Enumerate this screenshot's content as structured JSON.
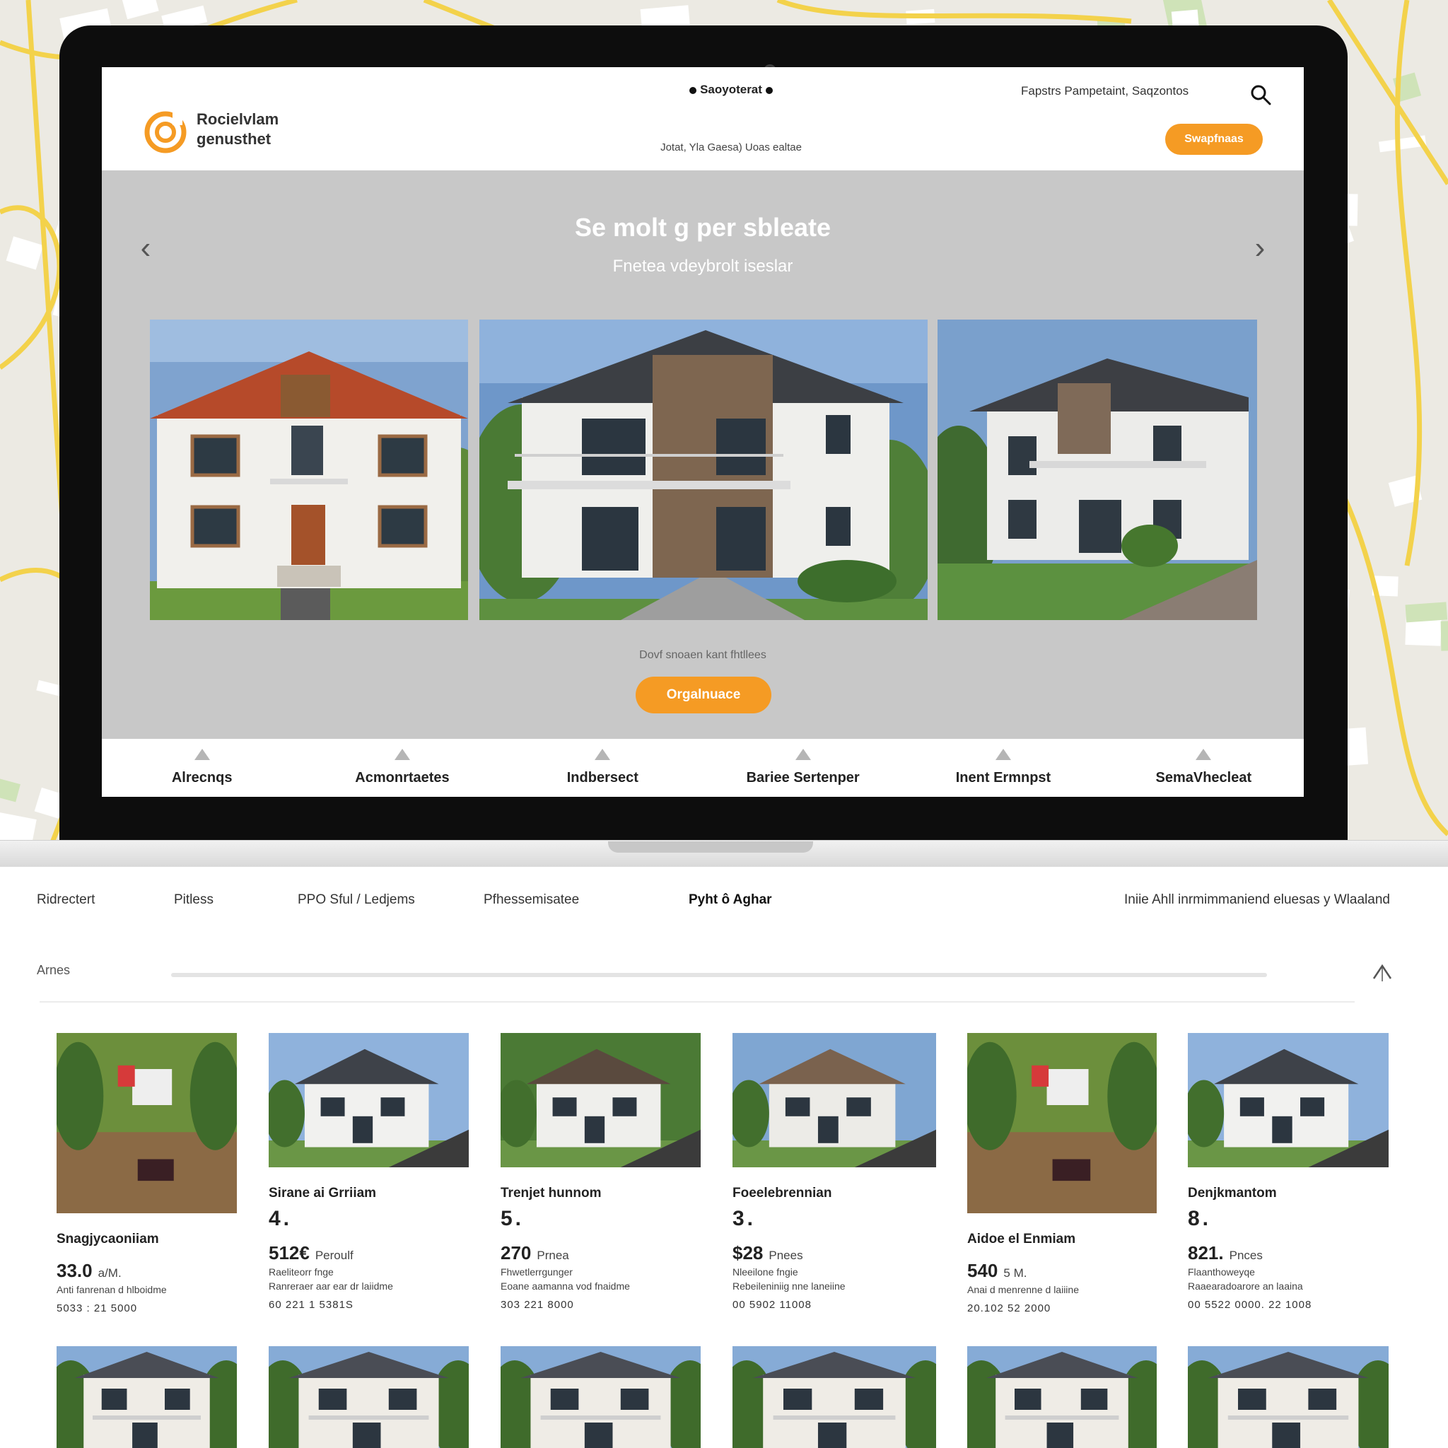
{
  "site": {
    "logo_line1": "Rocielvlam",
    "logo_line2": "genusthet",
    "name": "Saoyoterat",
    "tagline": "Jotat, Yla Gaesa) Uoas ealtae",
    "top_links": "Fapstrs Pampetaint,  Saqzontos",
    "cta_label": "Swapfnaas"
  },
  "hero": {
    "title": "Se molt g per sbleate",
    "subtitle": "Fnetea vdeybrolt iseslar",
    "note": "Dovf snoaen kant fhtllees",
    "cta_label": "Orgalnuace"
  },
  "categories": [
    {
      "label": "Alrecnqs"
    },
    {
      "label": "Acmonrtaetes"
    },
    {
      "label": "Indbersect"
    },
    {
      "label": "Bariee Sertenper"
    },
    {
      "label": "Inent Ermnpst"
    },
    {
      "label": "SemaVhecleat"
    }
  ],
  "nav2": {
    "items": [
      "Ridrectert",
      "Pitless",
      "PPO Sful / Ledjems",
      "Pfhessemisatee",
      "Pyht ô Aghar"
    ],
    "right": "Iniie Ahll inrmimmaniend eluesas y Wlaaland"
  },
  "filter": {
    "label": "Arnes"
  },
  "listings": [
    {
      "title": "Snagjycaoniiam",
      "count": "",
      "price": "33.0",
      "price_unit": "a/M.",
      "sub1": "",
      "sub2": "Anti fanrenan d hlboidme",
      "meta": "5033 : 21 5000"
    },
    {
      "title": "Sirane ai Grriiam",
      "count": "4.",
      "price": "512€",
      "price_unit": "Peroulf",
      "sub1": "Raeliteorr fnge",
      "sub2": "Ranreraer aar ear dr laiidme",
      "meta": "60 221 1 5381S"
    },
    {
      "title": "Trenjet hunnom",
      "count": "5.",
      "price": "270",
      "price_unit": "Prnea",
      "sub1": "Fhwetlerrgunger",
      "sub2": "Eoane aamanna vod fnaidme",
      "meta": "303 221 8000"
    },
    {
      "title": "Foeelebrennian",
      "count": "3.",
      "price": "$28",
      "price_unit": "Pnees",
      "sub1": "Nleeilone fngie",
      "sub2": "Rebeileniniig nne laneiine",
      "meta": "00 5902 11008"
    },
    {
      "title": "Aidoe el Enmiam",
      "count": "",
      "price": "540",
      "price_unit": "5 M.",
      "sub1": "",
      "sub2": "Anai d menrenne d laiiine",
      "meta": "20.102 52 2000"
    },
    {
      "title": "Denjkmantom",
      "count": "8.",
      "price": "821.",
      "price_unit": "Pnces",
      "sub1": "Flaanthoweyqe",
      "sub2": "Raaearadoarore an laaina",
      "meta": "00 5522 0000. 22 1008"
    }
  ],
  "colors": {
    "accent": "#f59b24",
    "hero_bg": "#c8c8c8",
    "laptop_bezel": "#0d0d0d"
  }
}
